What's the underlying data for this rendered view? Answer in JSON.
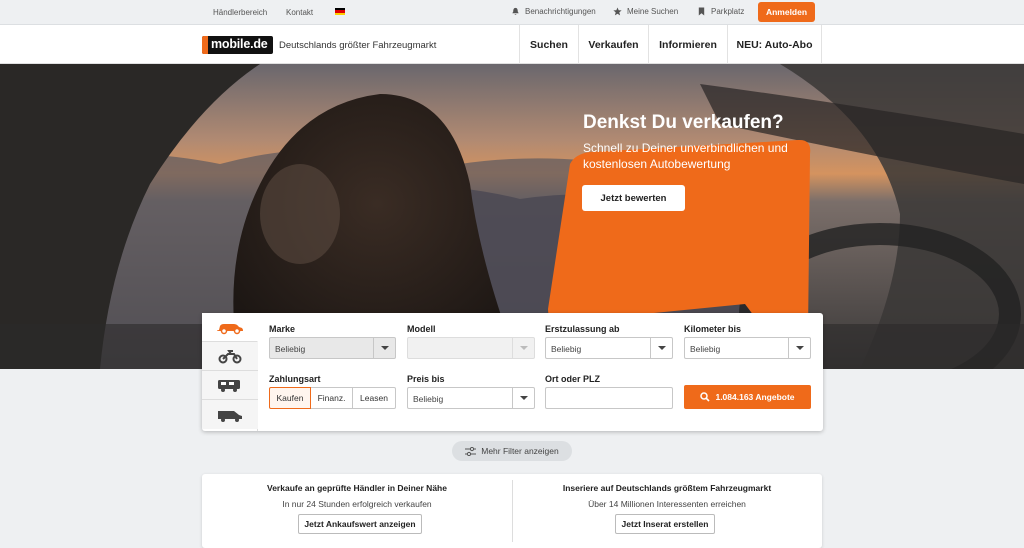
{
  "topbar": {
    "dealer_area": "Händlerbereich",
    "contact": "Kontakt",
    "notifications": "Benachrichtigungen",
    "my_searches": "Meine Suchen",
    "parking": "Parkplatz",
    "login": "Anmelden"
  },
  "header": {
    "logo": "mobile.de",
    "tagline": "Deutschlands größter Fahrzeugmarkt",
    "nav": [
      "Suchen",
      "Verkaufen",
      "Informieren",
      "NEU: Auto-Abo"
    ]
  },
  "promo": {
    "title": "Denkst Du verkaufen?",
    "subtitle": "Schnell zu Deiner unverbindlichen und kostenlosen Autobewertung",
    "button": "Jetzt bewerten"
  },
  "search": {
    "vehicle_tabs": [
      "car-icon",
      "motorbike-icon",
      "camper-icon",
      "van-icon"
    ],
    "brand": {
      "label": "Marke",
      "value": "Beliebig"
    },
    "model": {
      "label": "Modell",
      "value": ""
    },
    "registration": {
      "label": "Erstzulassung ab",
      "value": "Beliebig"
    },
    "mileage": {
      "label": "Kilometer bis",
      "value": "Beliebig"
    },
    "payment": {
      "label": "Zahlungsart",
      "options": [
        "Kaufen",
        "Finanz.",
        "Leasen"
      ],
      "selected": "Kaufen"
    },
    "price": {
      "label": "Preis bis",
      "value": "Beliebig"
    },
    "location": {
      "label": "Ort oder PLZ",
      "value": ""
    },
    "offers_button": "1.084.163 Angebote"
  },
  "more_filters": "Mehr Filter anzeigen",
  "cards": {
    "left": {
      "title": "Verkaufe an geprüfte Händler in Deiner Nähe",
      "subtitle": "In nur 24 Stunden erfolgreich verkaufen",
      "button": "Jetzt Ankaufswert anzeigen"
    },
    "right": {
      "title": "Inseriere auf Deutschlands größtem Fahrzeugmarkt",
      "subtitle": "Über 14 Millionen Interessenten erreichen",
      "button": "Jetzt Inserat erstellen"
    }
  },
  "colors": {
    "accent": "#ef6a1a",
    "text": "#222222"
  }
}
